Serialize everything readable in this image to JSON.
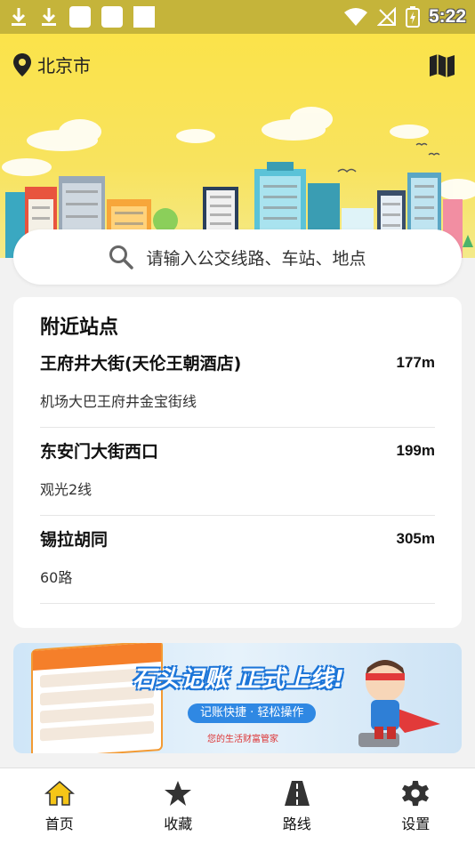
{
  "status_bar": {
    "time": "5:22",
    "icons": [
      "download-icon",
      "download-icon",
      "app-icon",
      "app-icon",
      "app-icon",
      "wifi-icon",
      "no-signal-icon",
      "battery-icon"
    ]
  },
  "header": {
    "city": "北京市",
    "location_icon": "location-pin-icon",
    "map_icon": "map-icon"
  },
  "search": {
    "placeholder": "请输入公交线路、车站、地点"
  },
  "nearby": {
    "title": "附近站点",
    "stops": [
      {
        "name": "王府井大街(天伦王朝酒店)",
        "distance": "177m",
        "lines": "机场大巴王府井金宝街线"
      },
      {
        "name": "东安门大街西口",
        "distance": "199m",
        "lines": "观光2线"
      },
      {
        "name": "锡拉胡同",
        "distance": "305m",
        "lines": "60路"
      }
    ]
  },
  "banner": {
    "title": "石头记账 正式上线!",
    "subtitle": "记账快捷 · 轻松操作",
    "tagline": "您的生活财富管家"
  },
  "nav": {
    "items": [
      {
        "label": "首页",
        "icon": "home-icon",
        "active": true
      },
      {
        "label": "收藏",
        "icon": "star-icon",
        "active": false
      },
      {
        "label": "路线",
        "icon": "road-icon",
        "active": false
      },
      {
        "label": "设置",
        "icon": "gear-icon",
        "active": false
      }
    ]
  },
  "colors": {
    "header_yellow": "#fbe34a",
    "status_bar": "#c5b43a",
    "home_active": "#f5c518"
  }
}
